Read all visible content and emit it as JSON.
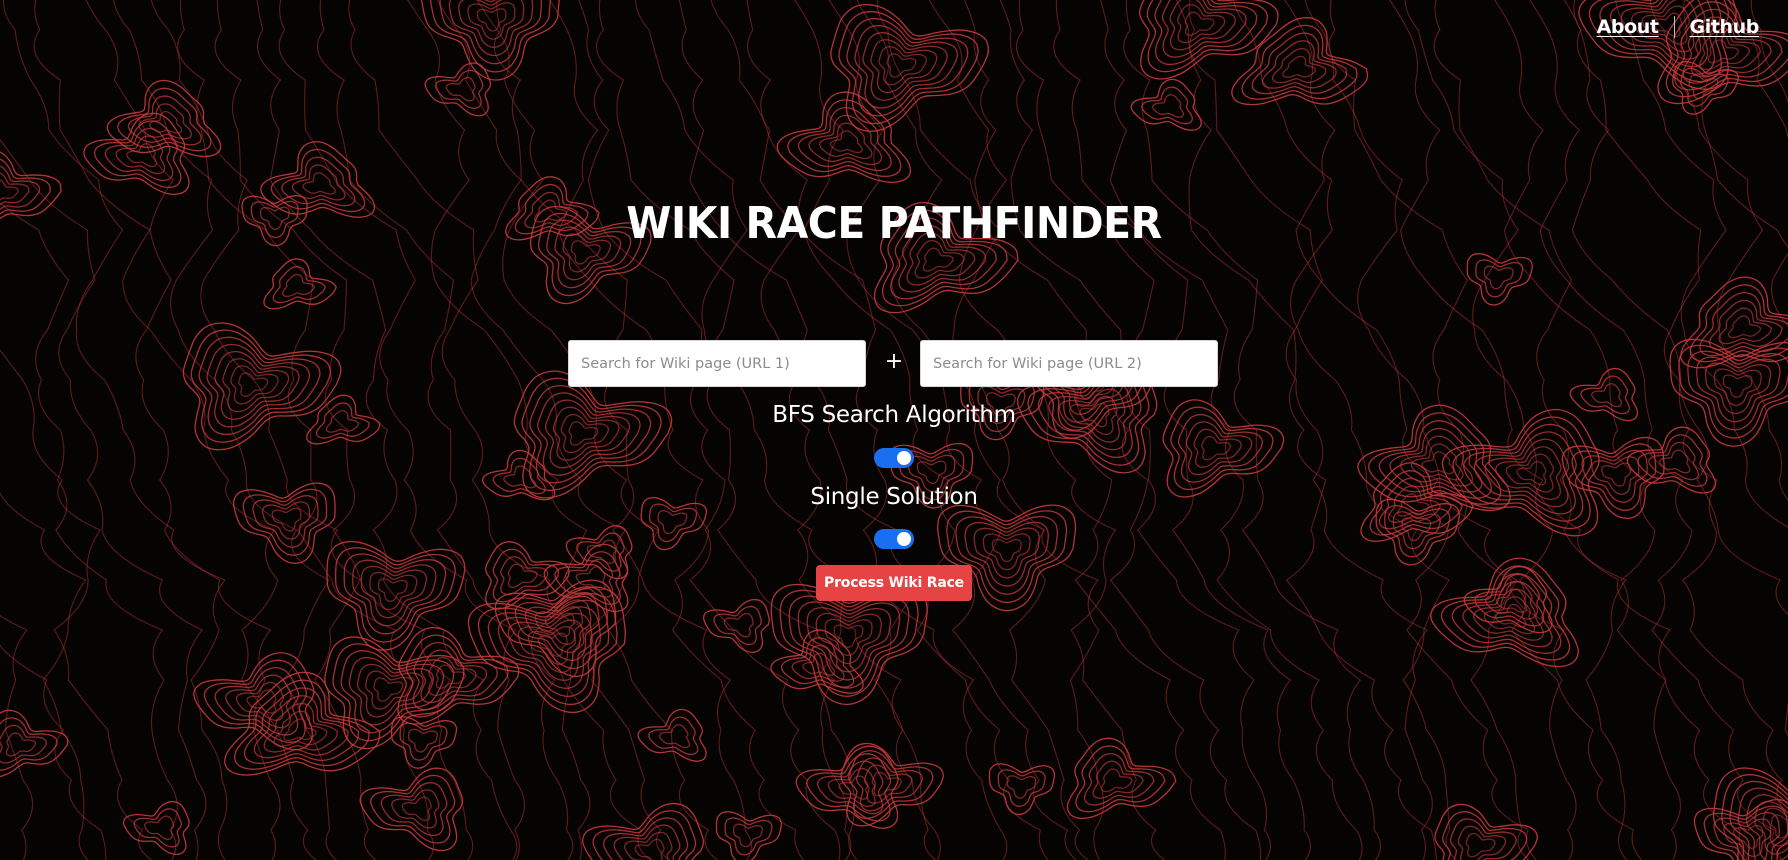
{
  "nav": {
    "about_label": "About",
    "github_label": "Github"
  },
  "title": "WIKI RACE PATHFINDER",
  "search": {
    "url1_placeholder": "Search for Wiki page (URL 1)",
    "url2_placeholder": "Search for Wiki page (URL 2)",
    "joiner": "+"
  },
  "options": {
    "bfs_label": "BFS Search Algorithm",
    "bfs_enabled": true,
    "single_label": "Single Solution",
    "single_enabled": true
  },
  "actions": {
    "process_label": "Process Wiki Race"
  },
  "colors": {
    "background": "#060303",
    "contour": "#c83a3a",
    "toggle_on": "#1a6ff0",
    "button": "#e64444",
    "text": "#ffffff"
  }
}
